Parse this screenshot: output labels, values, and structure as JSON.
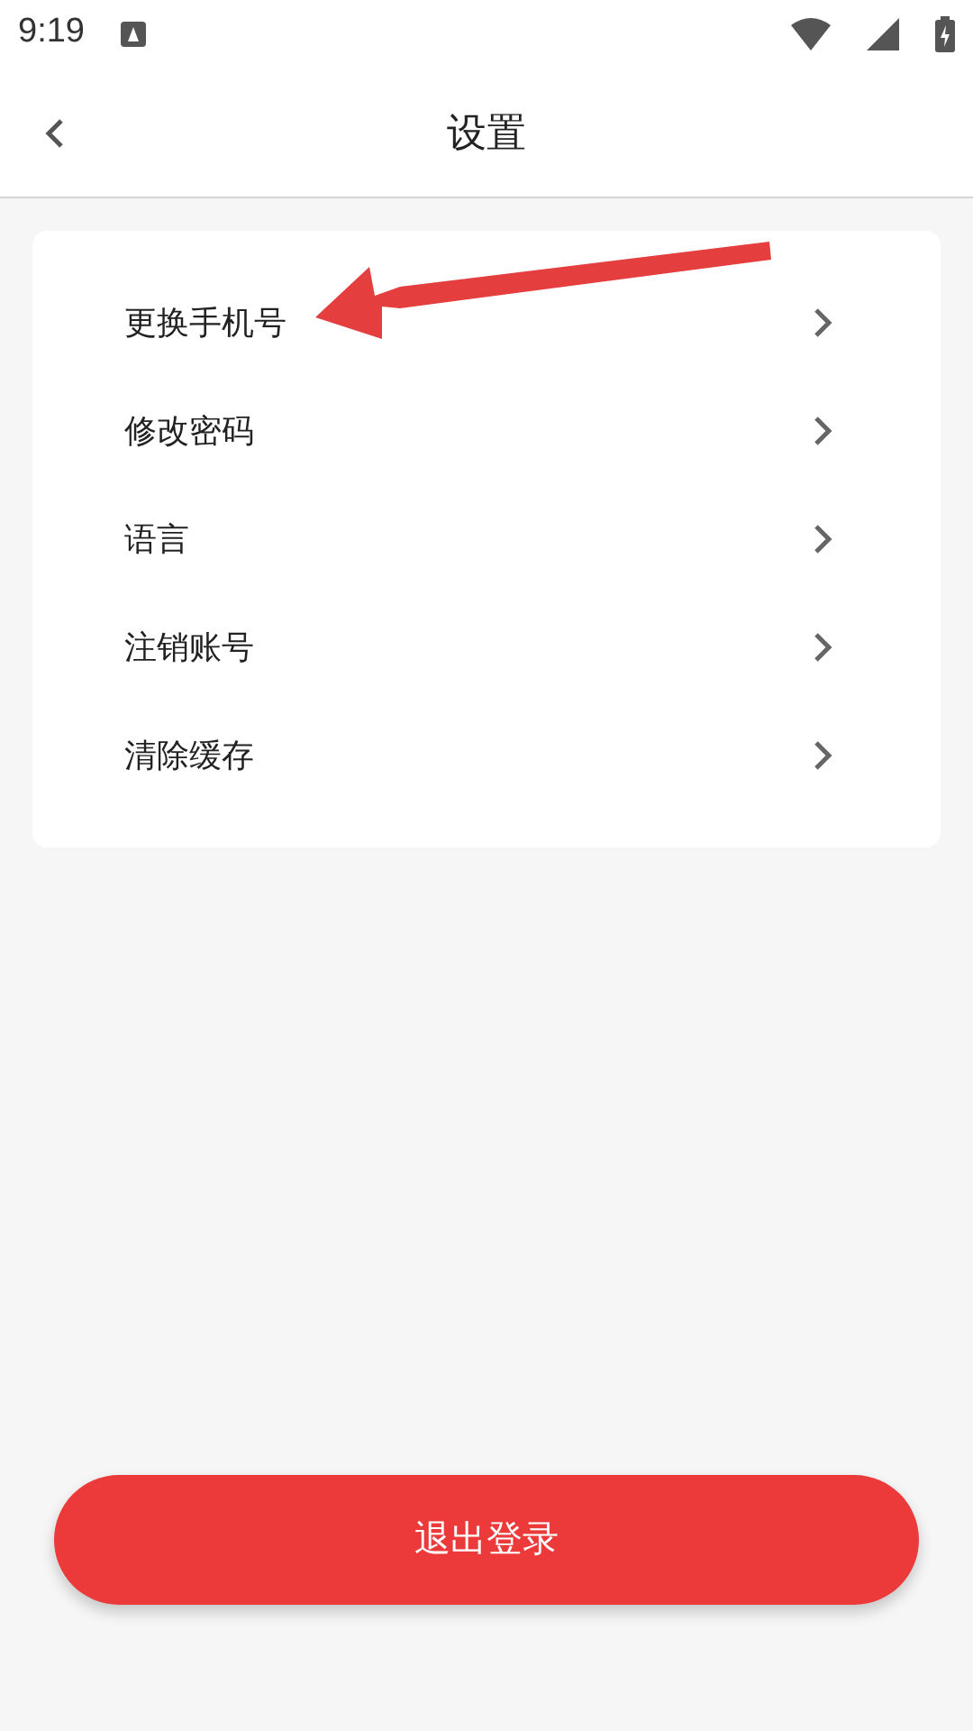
{
  "status_bar": {
    "time": "9:19"
  },
  "header": {
    "title": "设置"
  },
  "settings_items": [
    {
      "label": "更换手机号"
    },
    {
      "label": "修改密码"
    },
    {
      "label": "语言"
    },
    {
      "label": "注销账号"
    },
    {
      "label": "清除缓存"
    }
  ],
  "logout_button": {
    "label": "退出登录"
  }
}
